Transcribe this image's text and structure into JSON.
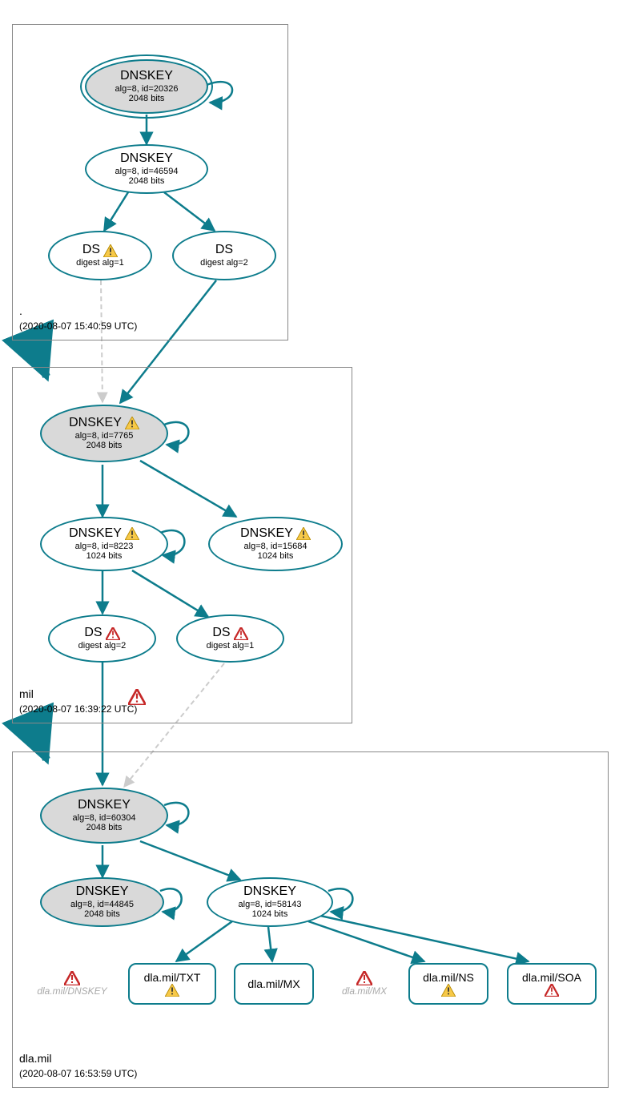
{
  "zones": {
    "root": {
      "label": ".",
      "timestamp": "(2020-08-07 15:40:59 UTC)"
    },
    "mil": {
      "label": "mil",
      "timestamp": "(2020-08-07 16:39:22 UTC)"
    },
    "dla": {
      "label": "dla.mil",
      "timestamp": "(2020-08-07 16:53:59 UTC)"
    }
  },
  "nodes": {
    "root_ksk": {
      "title": "DNSKEY",
      "sub1": "alg=8, id=20326",
      "sub2": "2048 bits"
    },
    "root_zsk": {
      "title": "DNSKEY",
      "sub1": "alg=8, id=46594",
      "sub2": "2048 bits"
    },
    "root_ds1": {
      "title": "DS",
      "sub1": "digest alg=1"
    },
    "root_ds2": {
      "title": "DS",
      "sub1": "digest alg=2"
    },
    "mil_ksk": {
      "title": "DNSKEY",
      "sub1": "alg=8, id=7765",
      "sub2": "2048 bits"
    },
    "mil_zsk1": {
      "title": "DNSKEY",
      "sub1": "alg=8, id=8223",
      "sub2": "1024 bits"
    },
    "mil_zsk2": {
      "title": "DNSKEY",
      "sub1": "alg=8, id=15684",
      "sub2": "1024 bits"
    },
    "mil_ds1": {
      "title": "DS",
      "sub1": "digest alg=2"
    },
    "mil_ds2": {
      "title": "DS",
      "sub1": "digest alg=1"
    },
    "dla_ksk": {
      "title": "DNSKEY",
      "sub1": "alg=8, id=60304",
      "sub2": "2048 bits"
    },
    "dla_zsk1": {
      "title": "DNSKEY",
      "sub1": "alg=8, id=44845",
      "sub2": "2048 bits"
    },
    "dla_zsk2": {
      "title": "DNSKEY",
      "sub1": "alg=8, id=58143",
      "sub2": "1024 bits"
    },
    "rr_txt": {
      "title": "dla.mil/TXT"
    },
    "rr_mx": {
      "title": "dla.mil/MX"
    },
    "rr_ns": {
      "title": "dla.mil/NS"
    },
    "rr_soa": {
      "title": "dla.mil/SOA"
    }
  },
  "ghosts": {
    "g_dnskey": "dla.mil/DNSKEY",
    "g_mx": "dla.mil/MX"
  },
  "colors": {
    "stroke": "#0d7c8c",
    "dashed": "#cccccc"
  }
}
